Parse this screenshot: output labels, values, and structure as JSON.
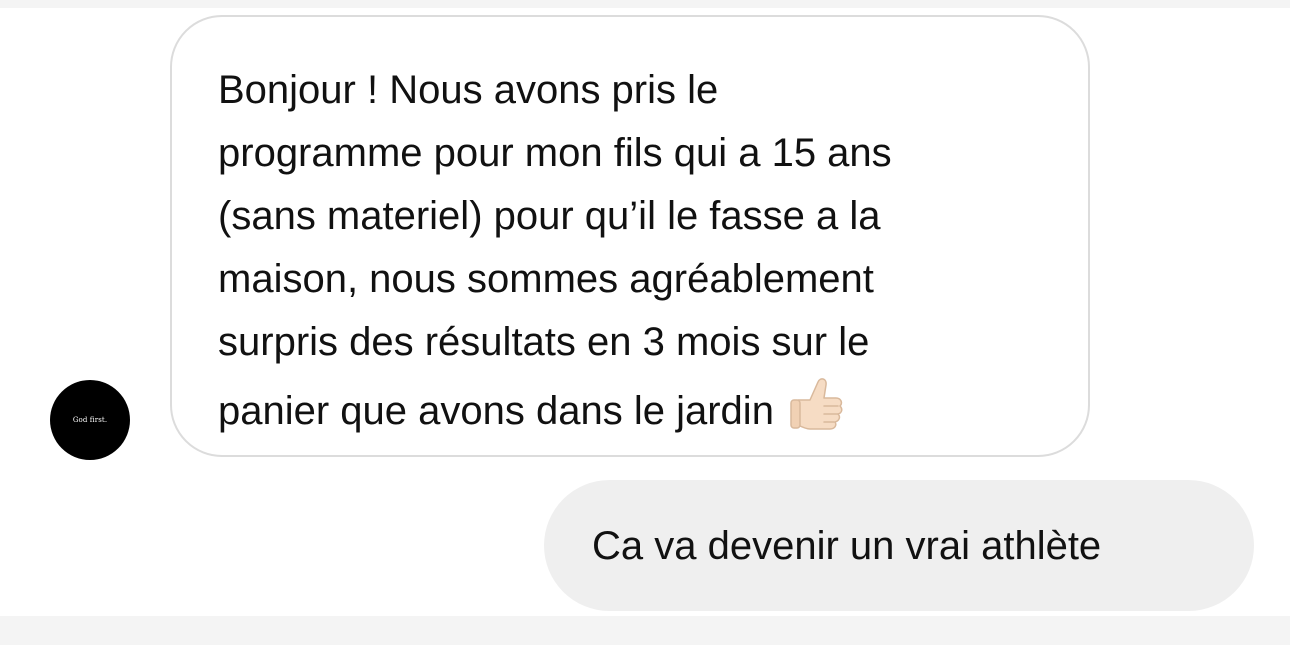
{
  "avatar": {
    "label": "God first."
  },
  "messages": [
    {
      "direction": "incoming",
      "text": "Bonjour ! Nous avons pris le\nprogramme pour mon fils qui a 15 ans\n(sans materiel) pour qu’il le fasse a la\nmaison, nous sommes agréablement\nsurpris des résultats en 3 mois sur le\npanier que avons dans le jardin",
      "trailing_icon": "thumbs-up-icon"
    },
    {
      "direction": "outgoing",
      "text": "Ca va devenir un vrai athlète"
    }
  ],
  "colors": {
    "incoming_bubble_border": "#dcdcdc",
    "outgoing_bubble_background": "#efefef",
    "avatar_background": "#000000",
    "text": "#111111"
  }
}
